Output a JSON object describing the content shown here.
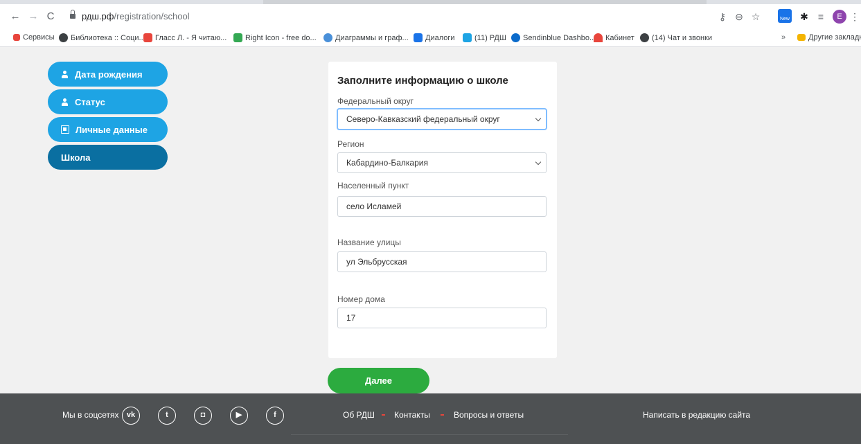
{
  "browser": {
    "url_host": "рдш.рф",
    "url_path": "/registration/school",
    "back_icon": "←",
    "forward_icon": "→",
    "reload_icon": "C",
    "avatar_letter": "E",
    "ext_new_label": "New"
  },
  "bookmarks": [
    {
      "label": "Сервисы",
      "color": "#e8453c"
    },
    {
      "label": "Библиотека :: Соци...",
      "color": "#3c4043"
    },
    {
      "label": "Гласс Л. - Я читаю...",
      "color": "#e8453c"
    },
    {
      "label": "Right Icon - free do...",
      "color": "#34a853"
    },
    {
      "label": "Диаграммы и граф...",
      "color": "#4a90d9"
    },
    {
      "label": "Диалоги",
      "color": "#1a73e8"
    },
    {
      "label": "(11) РДШ",
      "color": "#1ea4e4"
    },
    {
      "label": "Sendinblue Dashbo...",
      "color": "#0b6bcb"
    },
    {
      "label": "Кабинет",
      "color": "#e8453c"
    },
    {
      "label": "(14) Чат и звонки",
      "color": "#3c4043"
    },
    {
      "label": "»",
      "color": "#fff"
    },
    {
      "label": "Другие закладки",
      "color": "#f4b400"
    }
  ],
  "sidebar": {
    "items": [
      {
        "label": "Дата рождения",
        "icon": "person-icon"
      },
      {
        "label": "Статус",
        "icon": "person-icon"
      },
      {
        "label": "Личные данные",
        "icon": "id-card-icon"
      },
      {
        "label": "Школа",
        "icon": ""
      }
    ]
  },
  "form": {
    "title": "Заполните информацию о школе",
    "district_label": "Федеральный округ",
    "district_value": "Северо-Кавказский федеральный округ",
    "region_label": "Регион",
    "region_value": "Кабардино-Балкария",
    "settlement_label": "Населенный пункт",
    "settlement_value": "село Исламей",
    "street_label": "Название улицы",
    "street_value": "ул Эльбрусская",
    "house_label": "Номер дома",
    "house_value": "17",
    "next_label": "Далее"
  },
  "footer": {
    "social_label": "Мы в соцсетях",
    "social": [
      "vk",
      "t",
      "ig",
      "yt",
      "f"
    ],
    "links": [
      "Об РДШ",
      "Контакты",
      "Вопросы и ответы"
    ],
    "write_label": "Написать в редакцию сайта"
  },
  "colors": {
    "sidebar_blue": "#1ea4e4",
    "sidebar_active": "#0a6fa1",
    "next_green": "#2cab3f",
    "footer_bg": "#4e5153",
    "footer_dot": "#e8453c"
  }
}
